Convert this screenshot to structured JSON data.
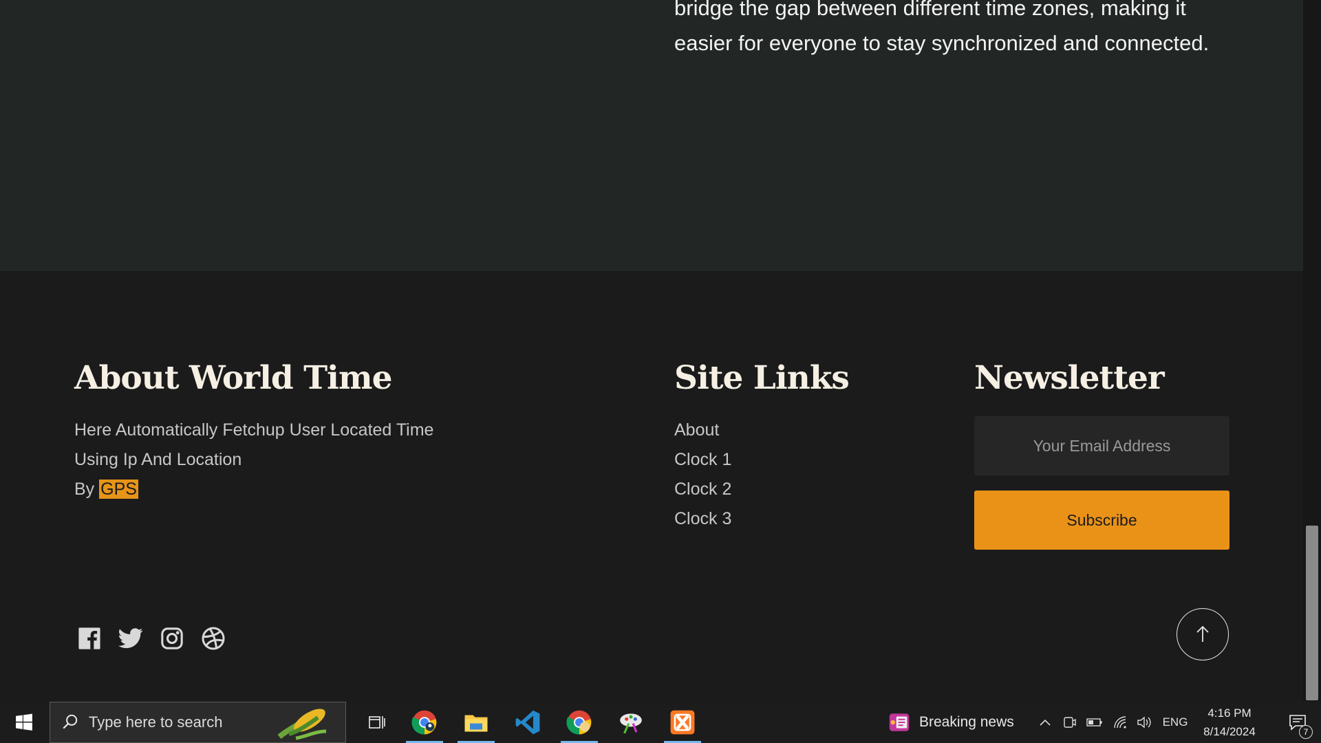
{
  "top_section": {
    "paragraph": "bridge the gap between different time zones, making it easier for everyone to stay synchronized and connected."
  },
  "footer": {
    "about": {
      "title": "About World Time",
      "text_line1": "Here Automatically Fetchup User Located Time",
      "text_line2": "Using Ip And Location",
      "by_prefix": "By ",
      "by_highlight": "GPS"
    },
    "links": {
      "title": "Site Links",
      "items": [
        "About",
        "Clock 1",
        "Clock 2",
        "Clock 3"
      ]
    },
    "newsletter": {
      "title": "Newsletter",
      "email_placeholder": "Your Email Address",
      "subscribe_label": "Subscribe"
    },
    "socials": [
      "facebook-icon",
      "twitter-icon",
      "instagram-icon",
      "dribbble-icon"
    ]
  },
  "taskbar": {
    "search_placeholder": "Type here to search",
    "apps": [
      "chrome-icon",
      "file-explorer-icon",
      "vscode-icon",
      "chrome-profile-icon",
      "paint-icon",
      "xampp-icon"
    ],
    "news_label": "Breaking news",
    "language": "ENG",
    "time": "4:16 PM",
    "date": "8/14/2024",
    "notification_count": "7"
  },
  "colors": {
    "accent": "#ea9218",
    "footer_bg": "#1b1b1b",
    "section_bg": "#222725"
  }
}
